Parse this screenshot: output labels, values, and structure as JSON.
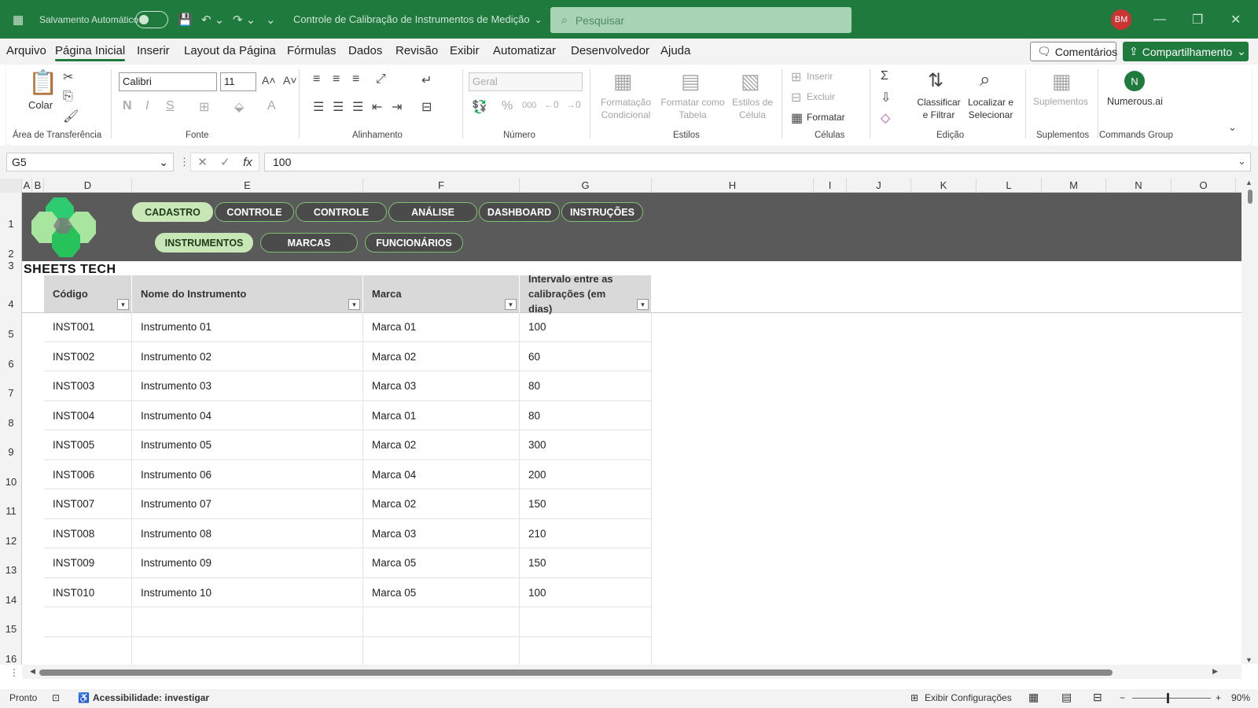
{
  "titlebar": {
    "autosave_label": "Salvamento Automático",
    "doc_title": "Controle de Calibração de Instrumentos de Medição",
    "search_placeholder": "Pesquisar",
    "avatar_initials": "BM"
  },
  "menu": {
    "items": [
      "Arquivo",
      "Página Inicial",
      "Inserir",
      "Layout da Página",
      "Fórmulas",
      "Dados",
      "Revisão",
      "Exibir",
      "Automatizar",
      "Desenvolvedor",
      "Ajuda"
    ],
    "active": "Página Inicial",
    "comments_label": "Comentários",
    "share_label": "Compartilhamento"
  },
  "ribbon": {
    "clipboard": {
      "paste_label": "Colar",
      "group_label": "Área de Transferência"
    },
    "font": {
      "font_name": "Calibri",
      "font_size": "11",
      "group_label": "Fonte"
    },
    "alignment": {
      "group_label": "Alinhamento"
    },
    "number": {
      "format": "Geral",
      "group_label": "Número"
    },
    "styles": {
      "conditional": "Formatação Condicional",
      "as_table": "Formatar como Tabela",
      "cell_styles": "Estilos de Célula",
      "group_label": "Estilos"
    },
    "cells": {
      "insert": "Inserir",
      "delete": "Excluir",
      "format": "Formatar",
      "group_label": "Células"
    },
    "editing": {
      "sort": "Classificar e Filtrar",
      "find": "Localizar e Selecionar",
      "group_label": "Edição"
    },
    "addins": {
      "label": "Suplementos",
      "group_label": "Suplementos"
    },
    "commands": {
      "label": "Numerous.ai",
      "group_label": "Commands Group"
    }
  },
  "formula_bar": {
    "cell_ref": "G5",
    "value": "100"
  },
  "columns": [
    "A",
    "B",
    "D",
    "E",
    "F",
    "G",
    "H",
    "I",
    "J",
    "K",
    "L",
    "M",
    "N",
    "O"
  ],
  "rows": [
    "1",
    "2",
    "3",
    "4",
    "5",
    "6",
    "7",
    "8",
    "9",
    "10",
    "11",
    "12",
    "13",
    "14",
    "15",
    "16"
  ],
  "nav": {
    "top": [
      "CADASTRO",
      "CONTROLE",
      "CONTROLE",
      "ANÁLISE",
      "DASHBOARD",
      "INSTRUÇÕES"
    ],
    "sub": [
      "INSTRUMENTOS",
      "MARCAS",
      "FUNCIONÁRIOS"
    ]
  },
  "logo_text": "SHEETS TECH",
  "table": {
    "headers": [
      "Código",
      "Nome do Instrumento",
      "Marca",
      "Intervalo entre as calibrações (em dias)"
    ],
    "rows": [
      [
        "INST001",
        "Instrumento 01",
        "Marca 01",
        "100"
      ],
      [
        "INST002",
        "Instrumento 02",
        "Marca 02",
        "60"
      ],
      [
        "INST003",
        "Instrumento 03",
        "Marca 03",
        "80"
      ],
      [
        "INST004",
        "Instrumento 04",
        "Marca 01",
        "80"
      ],
      [
        "INST005",
        "Instrumento 05",
        "Marca 02",
        "300"
      ],
      [
        "INST006",
        "Instrumento 06",
        "Marca 04",
        "200"
      ],
      [
        "INST007",
        "Instrumento 07",
        "Marca 02",
        "150"
      ],
      [
        "INST008",
        "Instrumento 08",
        "Marca 03",
        "210"
      ],
      [
        "INST009",
        "Instrumento 09",
        "Marca 05",
        "150"
      ],
      [
        "INST010",
        "Instrumento 10",
        "Marca 05",
        "100"
      ]
    ]
  },
  "status": {
    "ready": "Pronto",
    "accessibility": "Acessibilidade: investigar",
    "display_settings": "Exibir Configurações",
    "zoom": "90%"
  },
  "colors": {
    "excel_green": "#1f7a3e",
    "banner": "#5a5a5a",
    "pill_active": "#c7e7b7"
  }
}
